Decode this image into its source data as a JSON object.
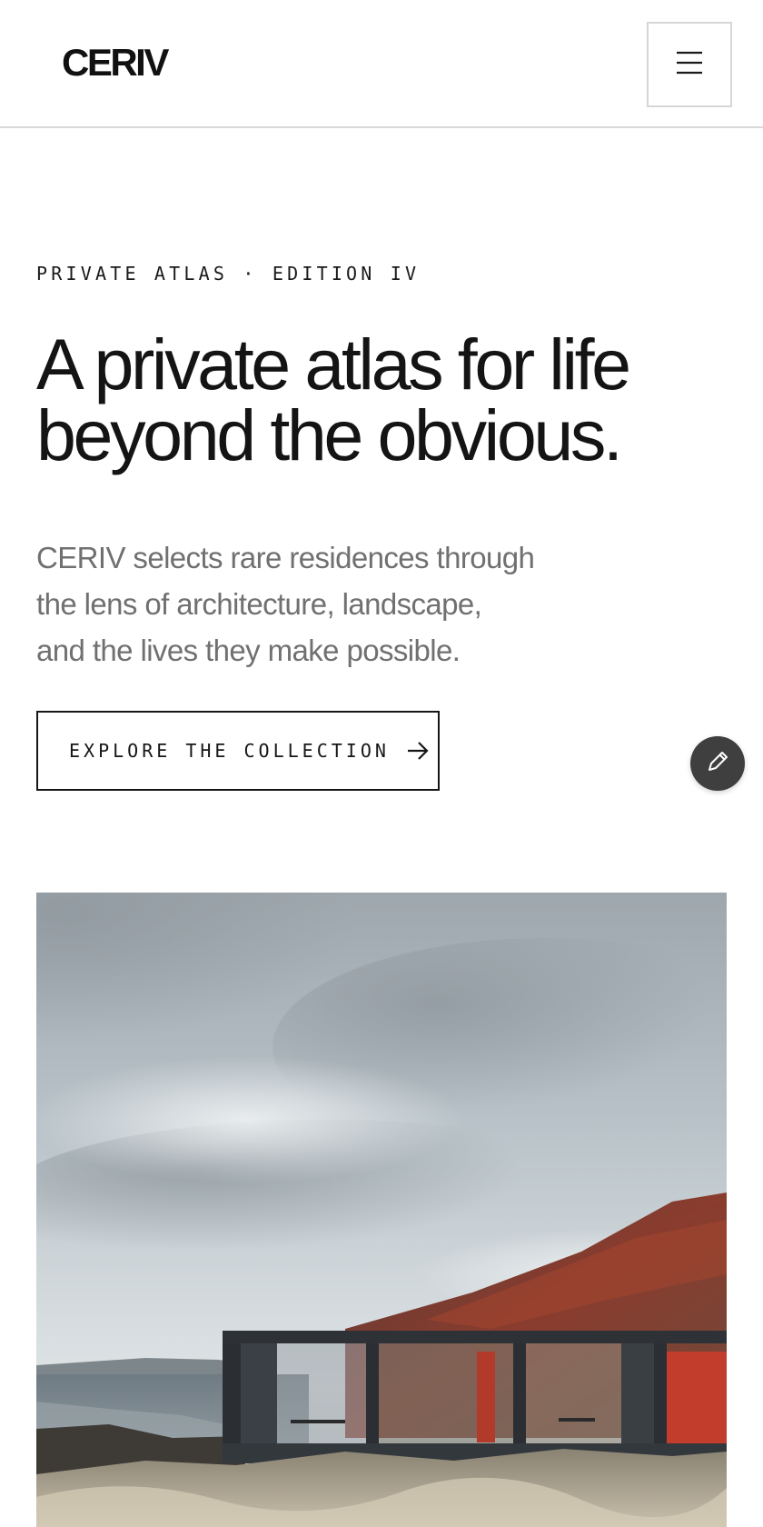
{
  "header": {
    "logo": "CERIV",
    "menu_icon": "hamburger-menu-icon"
  },
  "hero": {
    "eyebrow": "PRIVATE ATLAS · EDITION IV",
    "headline_line1": "A private atlas for life",
    "headline_line2": "beyond the obvious.",
    "lede_line1": "CERIV selects rare residences through",
    "lede_line2": "the lens of architecture, landscape,",
    "lede_line3": "and the lives they make possible.",
    "cta_label": "EXPLORE THE COLLECTION",
    "cta_icon": "arrow-right-icon"
  },
  "floating_action": {
    "icon": "pencil-icon"
  },
  "image": {
    "subject": "modern-black-pavilion-on-coastal-hillside-photo"
  },
  "colors": {
    "background": "#ffffff",
    "text": "#141414",
    "muted_text": "#707070",
    "fab": "#3f3f3f",
    "accent_red": "#c0392b"
  }
}
